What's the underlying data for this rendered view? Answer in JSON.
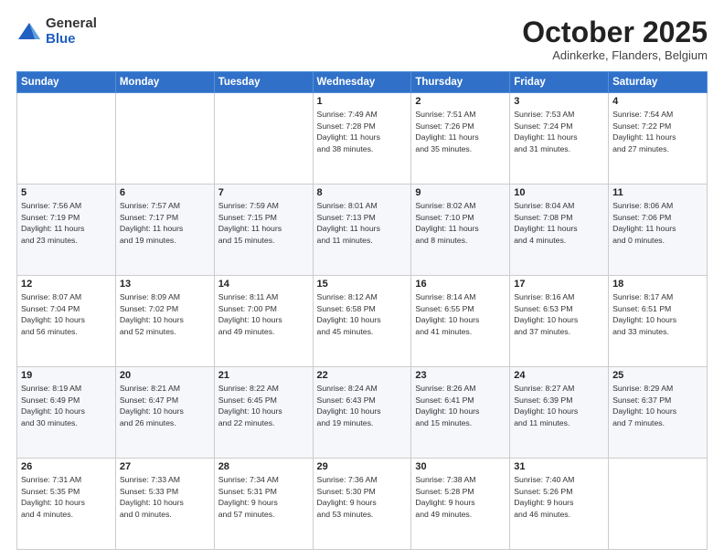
{
  "header": {
    "logo_general": "General",
    "logo_blue": "Blue",
    "month_title": "October 2025",
    "subtitle": "Adinkerke, Flanders, Belgium"
  },
  "weekdays": [
    "Sunday",
    "Monday",
    "Tuesday",
    "Wednesday",
    "Thursday",
    "Friday",
    "Saturday"
  ],
  "weeks": [
    [
      {
        "day": "",
        "info": ""
      },
      {
        "day": "",
        "info": ""
      },
      {
        "day": "",
        "info": ""
      },
      {
        "day": "1",
        "info": "Sunrise: 7:49 AM\nSunset: 7:28 PM\nDaylight: 11 hours\nand 38 minutes."
      },
      {
        "day": "2",
        "info": "Sunrise: 7:51 AM\nSunset: 7:26 PM\nDaylight: 11 hours\nand 35 minutes."
      },
      {
        "day": "3",
        "info": "Sunrise: 7:53 AM\nSunset: 7:24 PM\nDaylight: 11 hours\nand 31 minutes."
      },
      {
        "day": "4",
        "info": "Sunrise: 7:54 AM\nSunset: 7:22 PM\nDaylight: 11 hours\nand 27 minutes."
      }
    ],
    [
      {
        "day": "5",
        "info": "Sunrise: 7:56 AM\nSunset: 7:19 PM\nDaylight: 11 hours\nand 23 minutes."
      },
      {
        "day": "6",
        "info": "Sunrise: 7:57 AM\nSunset: 7:17 PM\nDaylight: 11 hours\nand 19 minutes."
      },
      {
        "day": "7",
        "info": "Sunrise: 7:59 AM\nSunset: 7:15 PM\nDaylight: 11 hours\nand 15 minutes."
      },
      {
        "day": "8",
        "info": "Sunrise: 8:01 AM\nSunset: 7:13 PM\nDaylight: 11 hours\nand 11 minutes."
      },
      {
        "day": "9",
        "info": "Sunrise: 8:02 AM\nSunset: 7:10 PM\nDaylight: 11 hours\nand 8 minutes."
      },
      {
        "day": "10",
        "info": "Sunrise: 8:04 AM\nSunset: 7:08 PM\nDaylight: 11 hours\nand 4 minutes."
      },
      {
        "day": "11",
        "info": "Sunrise: 8:06 AM\nSunset: 7:06 PM\nDaylight: 11 hours\nand 0 minutes."
      }
    ],
    [
      {
        "day": "12",
        "info": "Sunrise: 8:07 AM\nSunset: 7:04 PM\nDaylight: 10 hours\nand 56 minutes."
      },
      {
        "day": "13",
        "info": "Sunrise: 8:09 AM\nSunset: 7:02 PM\nDaylight: 10 hours\nand 52 minutes."
      },
      {
        "day": "14",
        "info": "Sunrise: 8:11 AM\nSunset: 7:00 PM\nDaylight: 10 hours\nand 49 minutes."
      },
      {
        "day": "15",
        "info": "Sunrise: 8:12 AM\nSunset: 6:58 PM\nDaylight: 10 hours\nand 45 minutes."
      },
      {
        "day": "16",
        "info": "Sunrise: 8:14 AM\nSunset: 6:55 PM\nDaylight: 10 hours\nand 41 minutes."
      },
      {
        "day": "17",
        "info": "Sunrise: 8:16 AM\nSunset: 6:53 PM\nDaylight: 10 hours\nand 37 minutes."
      },
      {
        "day": "18",
        "info": "Sunrise: 8:17 AM\nSunset: 6:51 PM\nDaylight: 10 hours\nand 33 minutes."
      }
    ],
    [
      {
        "day": "19",
        "info": "Sunrise: 8:19 AM\nSunset: 6:49 PM\nDaylight: 10 hours\nand 30 minutes."
      },
      {
        "day": "20",
        "info": "Sunrise: 8:21 AM\nSunset: 6:47 PM\nDaylight: 10 hours\nand 26 minutes."
      },
      {
        "day": "21",
        "info": "Sunrise: 8:22 AM\nSunset: 6:45 PM\nDaylight: 10 hours\nand 22 minutes."
      },
      {
        "day": "22",
        "info": "Sunrise: 8:24 AM\nSunset: 6:43 PM\nDaylight: 10 hours\nand 19 minutes."
      },
      {
        "day": "23",
        "info": "Sunrise: 8:26 AM\nSunset: 6:41 PM\nDaylight: 10 hours\nand 15 minutes."
      },
      {
        "day": "24",
        "info": "Sunrise: 8:27 AM\nSunset: 6:39 PM\nDaylight: 10 hours\nand 11 minutes."
      },
      {
        "day": "25",
        "info": "Sunrise: 8:29 AM\nSunset: 6:37 PM\nDaylight: 10 hours\nand 7 minutes."
      }
    ],
    [
      {
        "day": "26",
        "info": "Sunrise: 7:31 AM\nSunset: 5:35 PM\nDaylight: 10 hours\nand 4 minutes."
      },
      {
        "day": "27",
        "info": "Sunrise: 7:33 AM\nSunset: 5:33 PM\nDaylight: 10 hours\nand 0 minutes."
      },
      {
        "day": "28",
        "info": "Sunrise: 7:34 AM\nSunset: 5:31 PM\nDaylight: 9 hours\nand 57 minutes."
      },
      {
        "day": "29",
        "info": "Sunrise: 7:36 AM\nSunset: 5:30 PM\nDaylight: 9 hours\nand 53 minutes."
      },
      {
        "day": "30",
        "info": "Sunrise: 7:38 AM\nSunset: 5:28 PM\nDaylight: 9 hours\nand 49 minutes."
      },
      {
        "day": "31",
        "info": "Sunrise: 7:40 AM\nSunset: 5:26 PM\nDaylight: 9 hours\nand 46 minutes."
      },
      {
        "day": "",
        "info": ""
      }
    ]
  ]
}
